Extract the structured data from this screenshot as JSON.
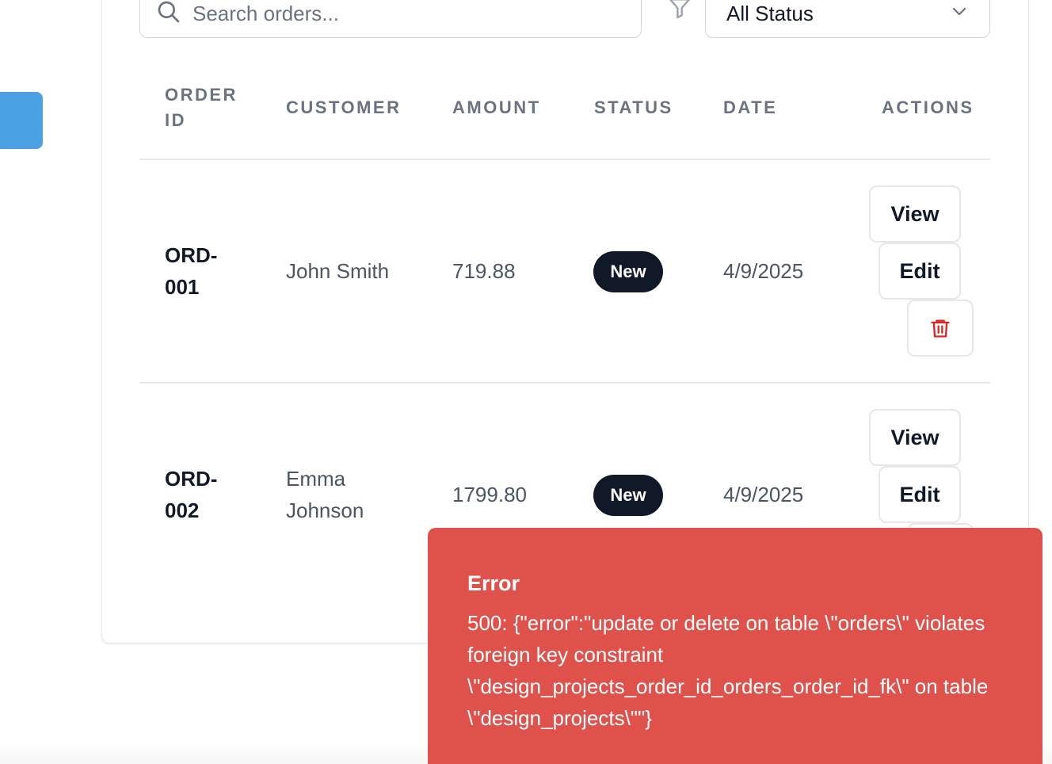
{
  "search": {
    "placeholder": "Search orders..."
  },
  "filter": {
    "selected": "All Status"
  },
  "table": {
    "headers": {
      "order_id": "ORDER ID",
      "customer": "CUSTOMER",
      "amount": "AMOUNT",
      "status": "STATUS",
      "date": "DATE",
      "actions": "ACTIONS"
    },
    "rows": [
      {
        "order_id_line1": "ORD-",
        "order_id_line2": "001",
        "customer": "John Smith",
        "amount": "719.88",
        "status": "New",
        "date": "4/9/2025"
      },
      {
        "order_id_line1": "ORD-",
        "order_id_line2": "002",
        "customer": "Emma Johnson",
        "amount": "1799.80",
        "status": "New",
        "date": "4/9/2025"
      }
    ],
    "actions": {
      "view": "View",
      "edit": "Edit"
    }
  },
  "toast": {
    "title": "Error",
    "message": "500: {\"error\":\"update or delete on table \\\"orders\\\" violates foreign key constraint \\\"design_projects_order_id_orders_order_id_fk\\\" on table \\\"design_projects\\\"\"}"
  },
  "colors": {
    "accent": "#4aa1e3",
    "badge": "#111827",
    "danger": "#df524c",
    "delete_icon": "#dc2626"
  },
  "icons": [
    "search-icon",
    "filter-icon",
    "chevron-down-icon",
    "trash-icon"
  ]
}
